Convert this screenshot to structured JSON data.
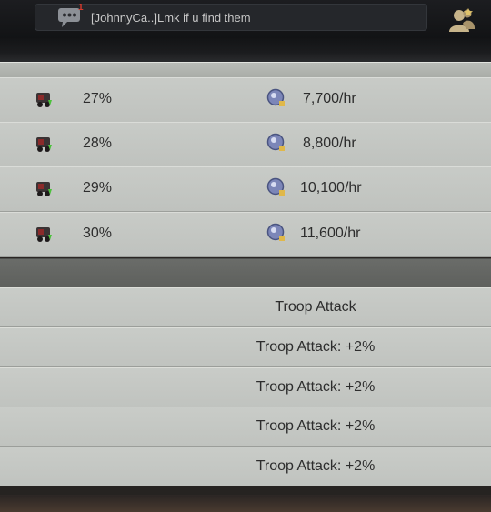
{
  "chat": {
    "message": "[JohnnyCa..]Lmk if u find them",
    "unread_count": "1"
  },
  "rates": [
    {
      "percent": "27%",
      "gain": "7,700/hr"
    },
    {
      "percent": "28%",
      "gain": "8,800/hr"
    },
    {
      "percent": "29%",
      "gain": "10,100/hr"
    },
    {
      "percent": "30%",
      "gain": "11,600/hr"
    }
  ],
  "troops": {
    "header": "Troop Attack",
    "rows": [
      "Troop Attack: +2%",
      "Troop Attack: +2%",
      "Troop Attack: +2%",
      "Troop Attack: +2%"
    ]
  },
  "icons": {
    "chat": "chat-bubble-icon",
    "friends": "friends-icon",
    "resource": "cart-resource-icon",
    "gem": "gem-orb-icon"
  },
  "colors": {
    "row_bg": "#c5c8c4",
    "divider_band": "#646663",
    "text": "#2d2d2d",
    "chat_text": "#c8c8c8",
    "badge": "#d83a2c"
  }
}
